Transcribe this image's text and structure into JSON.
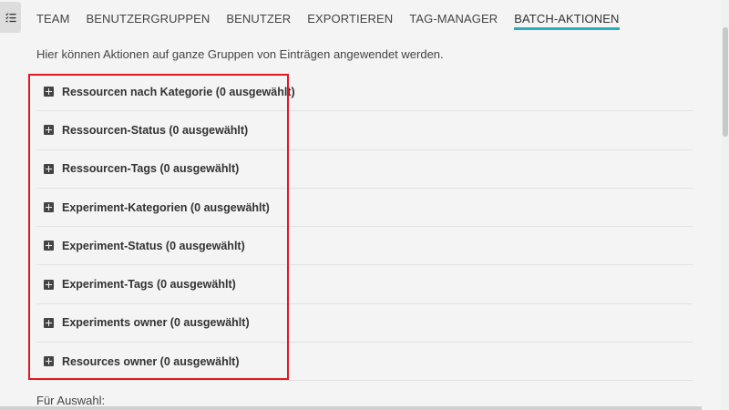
{
  "tabs": [
    {
      "label": "TEAM",
      "active": false
    },
    {
      "label": "BENUTZERGRUPPEN",
      "active": false
    },
    {
      "label": "BENUTZER",
      "active": false
    },
    {
      "label": "EXPORTIEREN",
      "active": false
    },
    {
      "label": "TAG-MANAGER",
      "active": false
    },
    {
      "label": "BATCH-AKTIONEN",
      "active": true
    }
  ],
  "intro_text": "Hier können Aktionen auf ganze Gruppen von Einträgen angewendet werden.",
  "groups": [
    {
      "label": "Ressourcen nach Kategorie (0 ausgewählt)"
    },
    {
      "label": "Ressourcen-Status (0 ausgewählt)"
    },
    {
      "label": "Ressourcen-Tags (0 ausgewählt)"
    },
    {
      "label": "Experiment-Kategorien (0 ausgewählt)"
    },
    {
      "label": "Experiment-Status (0 ausgewählt)"
    },
    {
      "label": "Experiment-Tags (0 ausgewählt)"
    },
    {
      "label": "Experiments owner (0 ausgewählt)"
    },
    {
      "label": "Resources owner (0 ausgewählt)"
    }
  ],
  "footer_label": "Für Auswahl:",
  "colors": {
    "accent": "#29aeb9",
    "highlight": "#e0191f"
  }
}
